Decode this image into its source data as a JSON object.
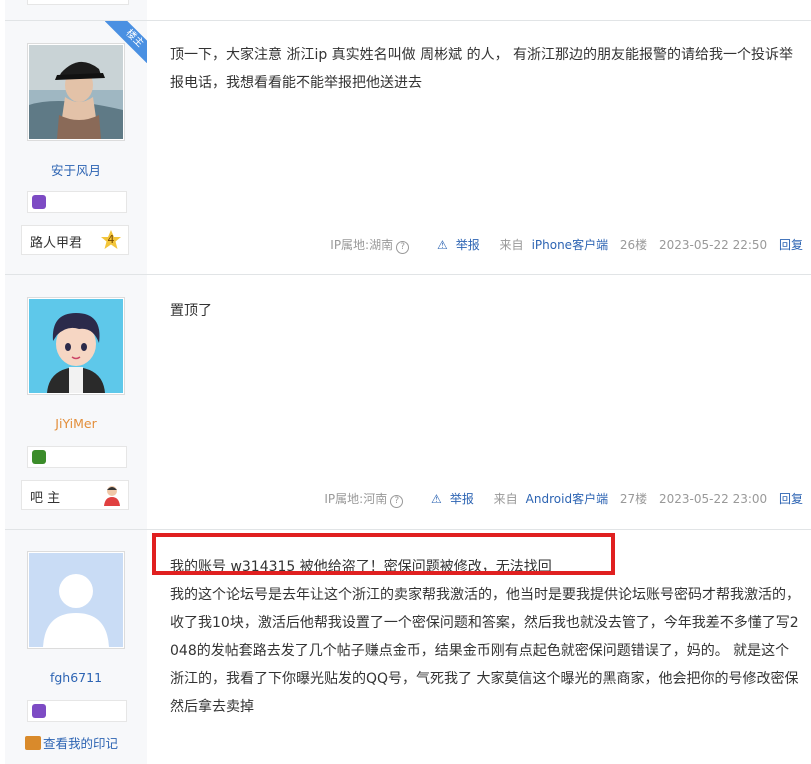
{
  "posts": [
    {
      "user": "安于风月",
      "ribbon": "楼主",
      "content": "顶一下，大家注意 浙江ip 真实姓名叫做 周彬斌 的人， 有浙江那边的朋友能报警的请给我一个投诉举报电话，我想看看能不能举报把他送进去",
      "rank_title": "路人甲君",
      "rank_level": "4",
      "ip": "IP属地:湖南",
      "report": "举报",
      "client_prefix": "来自",
      "client": "iPhone客户端",
      "floor": "26楼",
      "time": "2023-05-22 22:50",
      "reply": "回复"
    },
    {
      "user": "JiYiMer",
      "content": "置顶了",
      "rank_title": "吧 主",
      "ip": "IP属地:河南",
      "report": "举报",
      "client_prefix": "来自",
      "client": "Android客户端",
      "floor": "27楼",
      "time": "2023-05-22 23:00",
      "reply": "回复"
    },
    {
      "user": "fgh6711",
      "content_head": "我的账号 w314315 被他给盗了！密保问题被修改，无法找回",
      "content_body": "我的这个论坛号是去年让这个浙江的卖家帮我激活的，他当时是要我提供论坛账号密码才帮我激活的，收了我10块，激活后他帮我设置了一个密保问题和答案，然后我也就没去管了，今年我差不多懂了写2048的发帖套路去发了几个帖子赚点金币，结果金币刚有点起色就密保问题错误了，妈的。 就是这个浙江的，我看了下你曝光贴发的QQ号，气死我了 大家莫信这个曝光的黑商家，他会把你的号修改密保然后拿去卖掉",
      "footprint": "查看我的印记"
    }
  ],
  "colors": {
    "accent": "#2d64b3",
    "username_orange": "#e38e3a",
    "highlight_red": "#e02020",
    "ribbon_blue": "#4a90e2"
  }
}
